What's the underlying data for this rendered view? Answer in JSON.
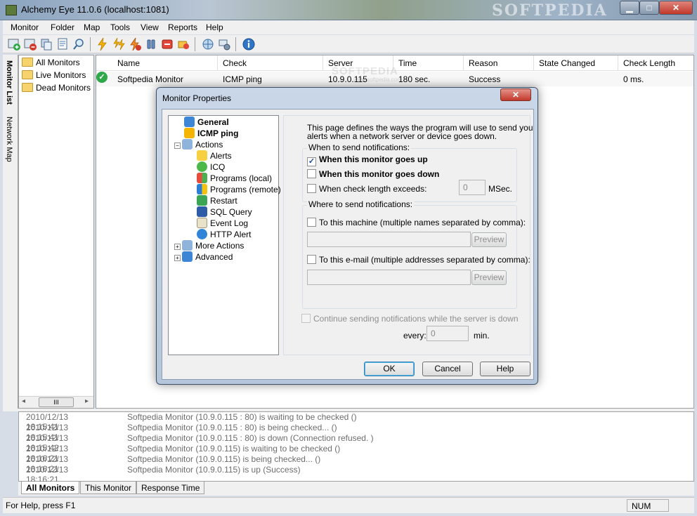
{
  "window": {
    "title": "Alchemy Eye 11.0.6 (localhost:1081)",
    "watermark": "SOFTPEDIA",
    "min_glyph": "▁",
    "max_glyph": "□",
    "close_glyph": "✕"
  },
  "menu": [
    "Monitor",
    "Folder",
    "Map",
    "Tools",
    "View",
    "Reports",
    "Help"
  ],
  "side_tabs": {
    "monitor_list": "Monitor List",
    "network_map": "Network Map"
  },
  "tree": {
    "items": [
      "All Monitors",
      "Live Monitors",
      "Dead Monitors"
    ],
    "scroll_left": "◂",
    "scroll_thumb": "III",
    "scroll_right": "▸"
  },
  "list": {
    "columns": [
      "Name",
      "Check",
      "Server",
      "Time",
      "Reason",
      "State Changed",
      "Check Length"
    ],
    "rows": [
      {
        "name": "Softpedia Monitor",
        "check": "ICMP ping",
        "server": "10.9.0.115",
        "time": "180 sec.",
        "reason": "Success",
        "state_changed": "",
        "check_length": "0 ms."
      }
    ],
    "watermark": "SOFTPEDIA",
    "watermark_url": "www.softpedia.com"
  },
  "log": [
    {
      "ts": "2010/12/13 18:15:41",
      "msg": "Softpedia Monitor (10.9.0.115 : 80) is waiting to be checked ()"
    },
    {
      "ts": "2010/12/13 18:15:41",
      "msg": "Softpedia Monitor (10.9.0.115 : 80) is being checked... ()"
    },
    {
      "ts": "2010/12/13 18:15:42",
      "msg": "Softpedia Monitor (10.9.0.115 : 80) is down (Connection refused. )"
    },
    {
      "ts": "2010/12/13 18:16:21",
      "msg": "Softpedia Monitor (10.9.0.115) is waiting to be checked ()"
    },
    {
      "ts": "2010/12/13 18:16:21",
      "msg": "Softpedia Monitor (10.9.0.115) is being checked... ()"
    },
    {
      "ts": "2010/12/13 18:16:21",
      "msg": "Softpedia Monitor (10.9.0.115) is up (Success)"
    }
  ],
  "log_tabs": [
    "All Monitors",
    "This Monitor",
    "Response Time"
  ],
  "status": {
    "help": "For Help, press F1",
    "num": "NUM"
  },
  "dialog": {
    "title": "Monitor Properties",
    "close_glyph": "✕",
    "tree": {
      "general": "General",
      "icmp": "ICMP ping",
      "actions": "Actions",
      "action_items": [
        "Alerts",
        "ICQ",
        "Programs (local)",
        "Programs (remote)",
        "Restart",
        "SQL Query",
        "Event Log",
        "HTTP Alert"
      ],
      "more_actions": "More Actions",
      "advanced": "Advanced"
    },
    "intro_line1": "This page defines the ways the program will use to send you",
    "intro_line2": "alerts when a network server or device goes down.",
    "when_group": "When to send notifications:",
    "when_up": "When this monitor goes up",
    "when_up_checked": true,
    "when_down": "When this monitor goes down",
    "when_length": "When check length exceeds:",
    "length_value": "0",
    "length_unit": "MSec.",
    "where_group": "Where to send notifications:",
    "to_machine": "To this machine (multiple names separated by comma):",
    "to_email": "To this e-mail (multiple addresses separated by comma):",
    "preview": "Preview",
    "continue": "Continue sending notifications while the server is down",
    "every": "every:",
    "every_value": "0",
    "every_unit": "min.",
    "ok": "OK",
    "cancel": "Cancel",
    "help": "Help"
  },
  "colors": {
    "ok_green": "#2fa84a",
    "dialog_frame": "#c9d7e8",
    "close_red": "#c2392b"
  },
  "icons": {
    "toolbar": [
      "new-monitor-icon",
      "delete-monitor-icon",
      "copy-icon",
      "properties-icon",
      "find-icon",
      "check-icon",
      "check-all-icon",
      "check-failed-icon",
      "pause-icon",
      "stop-icon",
      "alert-icon",
      "network-icon",
      "network-settings-icon",
      "info-icon"
    ]
  }
}
